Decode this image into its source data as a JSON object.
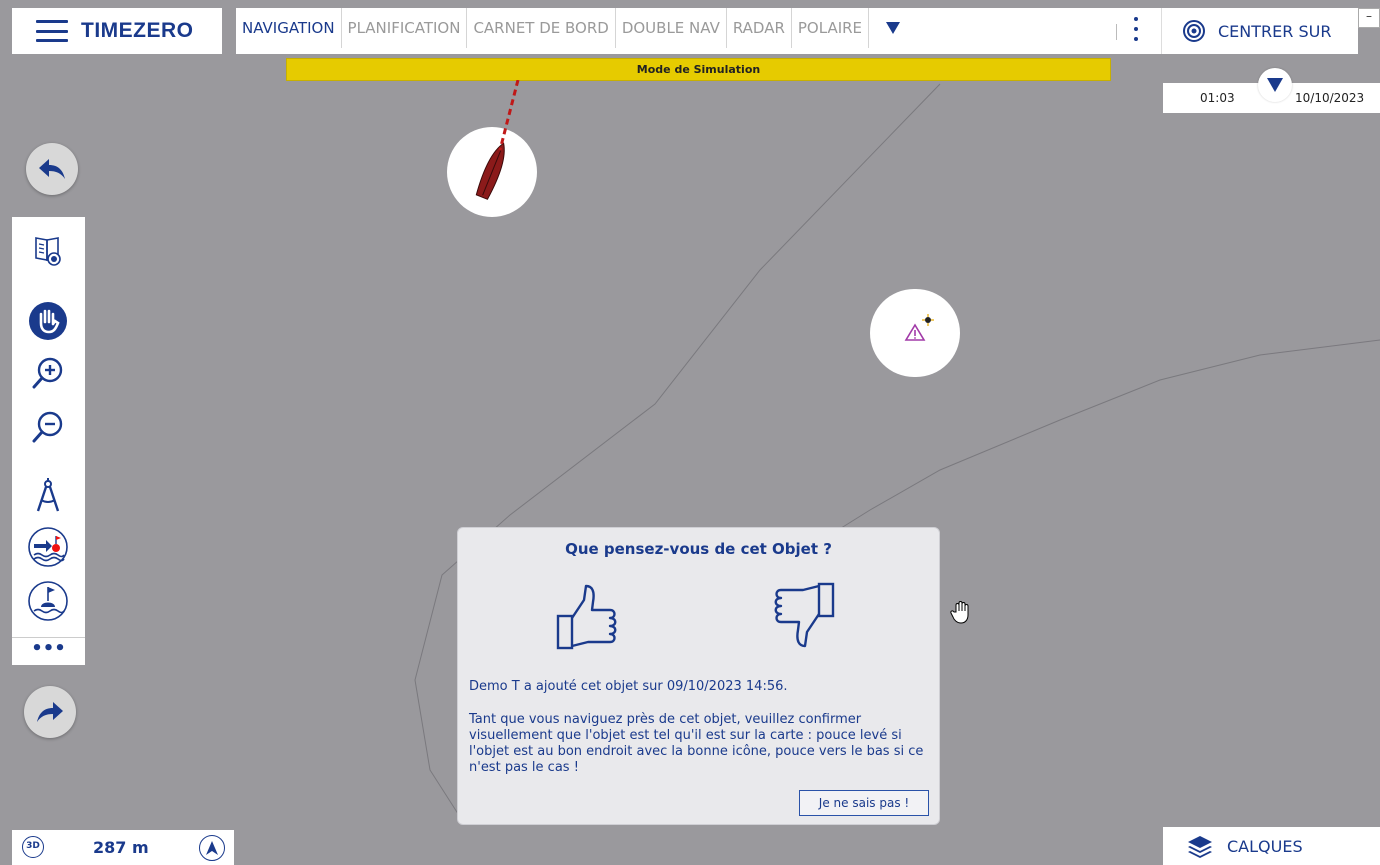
{
  "app": {
    "brand": "TIMEZERO",
    "menu_icon": "hamburger-icon"
  },
  "tabs": [
    {
      "label": "NAVIGATION",
      "active": true
    },
    {
      "label": "PLANIFICATION",
      "active": false
    },
    {
      "label": "CARNET DE BORD",
      "active": false
    },
    {
      "label": "DOUBLE NAV",
      "active": false
    },
    {
      "label": "RADAR",
      "active": false
    },
    {
      "label": "POLAIRE",
      "active": false
    }
  ],
  "header": {
    "center_label": "CENTRER SUR",
    "center_icon": "target-icon",
    "minimize_label": "–"
  },
  "banner": {
    "text": "Mode de Simulation",
    "color": "#e6cb00"
  },
  "time": {
    "time": "01:03",
    "date": "10/10/2023"
  },
  "toolbar": {
    "icons": [
      "book-target-icon",
      "hand-pan-icon",
      "zoom-in-icon",
      "zoom-out-icon",
      "compass-divider-icon",
      "route-buoy-icon",
      "buoy-icon"
    ],
    "more": "•••"
  },
  "dialog": {
    "title": "Que pensez-vous de cet Objet ?",
    "added_by": "Demo T a ajouté cet objet sur 09/10/2023 14:56.",
    "body": "Tant que vous naviguez près de cet objet, veuillez confirmer visuellement que l'objet est tel qu'il est sur la carte : pouce levé si l'objet est au bon endroit avec la bonne icône, pouce vers le bas si ce n'est pas le cas !",
    "dont_know": "Je ne sais pas !"
  },
  "bottom": {
    "mode_3d": "3D",
    "scale": "287 m",
    "layers_label": "CALQUES"
  },
  "colors": {
    "accent": "#1a3a8c",
    "map": "#9a999d",
    "boat": "#8b1a1a"
  }
}
